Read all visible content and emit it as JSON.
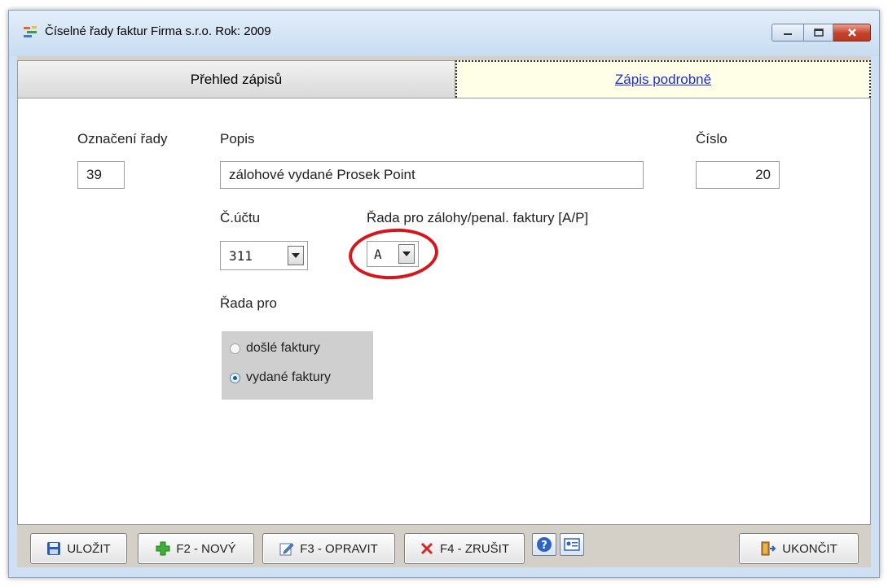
{
  "window": {
    "title": "Číselné řady faktur  Firma s.r.o.  Rok: 2009",
    "icon": "rows-icon"
  },
  "tabs": [
    {
      "label": "Přehled zápisů",
      "active": false
    },
    {
      "label": "Zápis podrobně",
      "active": true
    }
  ],
  "form": {
    "oznaceni_label": "Označení řady",
    "oznaceni_value": "39",
    "popis_label": "Popis",
    "popis_value": "zálohové vydané Prosek Point",
    "cislo_label": "Číslo",
    "cislo_value": "20",
    "ucet_label": "Č.účtu",
    "ucet_value": "311",
    "rada_zalohy_label": "Řada pro zálohy/penal. faktury  [A/P]",
    "rada_zalohy_value": "A",
    "rada_pro_label": "Řada pro",
    "radio_options": [
      {
        "label": "došlé faktury",
        "selected": false
      },
      {
        "label": "vydané faktury",
        "selected": true
      }
    ]
  },
  "toolbar": {
    "save": "ULOŽIT",
    "new": "F2 - NOVÝ",
    "edit": "F3 - OPRAVIT",
    "delete": "F4 - ZRUŠIT",
    "exit": "UKONČIT"
  },
  "colors": {
    "highlight_ring": "#d5161c",
    "active_tab_bg": "#ffffe8",
    "link_blue": "#1c2ed6"
  }
}
